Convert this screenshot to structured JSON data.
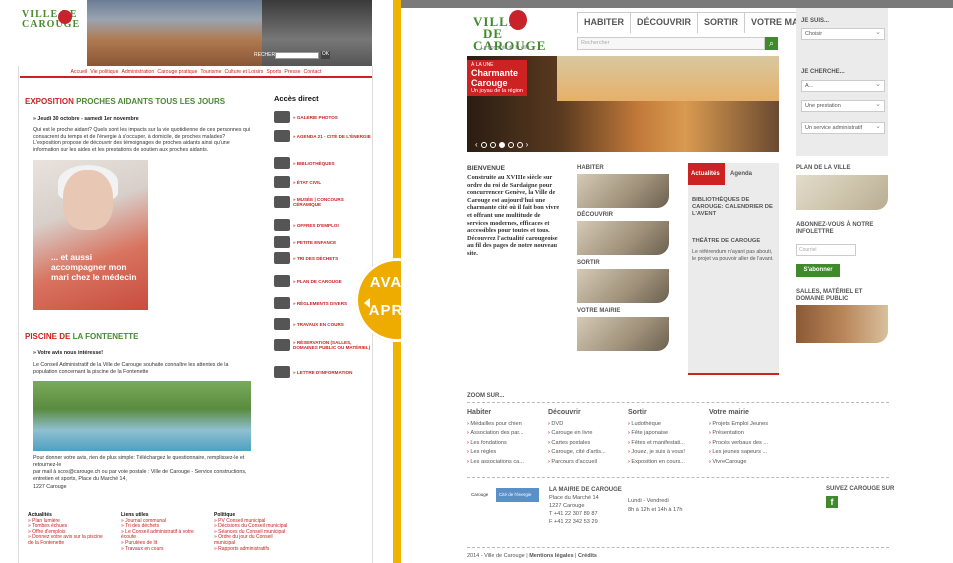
{
  "old": {
    "logo": "VILLE DE CAROUGE",
    "search_label": "RECHERCHE",
    "search_btn": "OK",
    "nav": [
      "Accueil",
      "Vie politique",
      "Administration",
      "Carouge pratique",
      "Tourisme",
      "Culture et Loisirs",
      "Sports",
      "Presse",
      "Contact"
    ],
    "headline_red": "EXPOSITION",
    "headline_green": "PROCHES AIDANTS TOUS LES JOURS",
    "date": "Jeudi 30 octobre - samedi 1er novembre",
    "body": "Qui est le proche aidant? Quels sont les impacts sur la vie quotidienne de ces personnes qui consacrent du temps et de l'énergie à s'occuper, à domicile, de proches malades? L'exposition propose de découvrir des témoignages de proches aidants ainsi qu'une information sur les aides et les prestations de soutien aux proches aidants.",
    "poster_text": "... et aussi accompagner mon mari chez le médecin",
    "h2_red": "PISCINE DE",
    "h2_green": "LA FONTENETTE",
    "sub2": "Votre avis nous intéresse!",
    "body2": "Le Conseil Administratif de la Ville de Carouge souhaite connaître les attentes de la population concernant la piscine de la Fontenette",
    "body3": "Pour donner votre avis, rien de plus simple: Téléchargez le questionnaire, remplissez-le et retournez-le",
    "body4": "par mail à scos@carouge.ch ou par voie postale : Ville de Carouge - Service constructions, entretien et sports, Place du Marché 14,",
    "body5": "1227 Carouge",
    "acces_title": "Accès direct",
    "acces": [
      "GALERIE PHOTOS",
      "AGENDA 21 - CITÉ DE L'ÉNERGIE",
      "BIBLIOTHÈQUES",
      "ÉTAT CIVIL",
      "MUSÉE | CONCOURS CÉRAMIQUE",
      "OFFRES D'EMPLOI",
      "PETITE ENFANCE",
      "TRI DES DÉCHETS",
      "PLAN DE CAROUGE",
      "RÈGLEMENTS DIVERS",
      "TRAVAUX EN COURS",
      "RÉSERVATION (SALLES, DOMAINES PUBLIC OU MATÉRIEL)",
      "LETTRE D'INFORMATION"
    ],
    "footer": [
      {
        "h": "Actualités",
        "items": [
          "Plan lumière",
          "Tombes échues",
          "Offre d'emplois",
          "Donnez votre avis sur la piscine de la Fontenette"
        ]
      },
      {
        "h": "Liens utiles",
        "items": [
          "Journal communal",
          "Tri des déchets",
          "Le Conseil administratif à votre écoute",
          "Purutées de lit",
          "Travaux en cours"
        ]
      },
      {
        "h": "Politique",
        "items": [
          "PV Conseil municipal",
          "Décisions du Conseil municipal",
          "Séances du Conseil municipal",
          "Ordre du jour du Conseil municipal",
          "Rapports administratifs"
        ]
      }
    ]
  },
  "badge": {
    "before": "AVANT",
    "after": "APRÈS"
  },
  "new": {
    "logo_line1": "VILLE",
    "logo_line2": "DE",
    "logo_line3": "CAROUGE",
    "tagline": "Le bon côté de la ville",
    "nav": [
      "HABITER",
      "DÉCOUVRIR",
      "SORTIR",
      "VOTRE MAIRIE"
    ],
    "search_placeholder": "Rechercher",
    "je_suis": "JE SUIS...",
    "choisir": "Choisir",
    "je_cherche": "JE CHERCHE...",
    "sel_a": "A...",
    "sel_prestation": "Une prestation",
    "sel_service": "Un service administratif",
    "hero_kicker": "À LA UNE",
    "hero_title": "Charmante Carouge",
    "hero_sub": "Un joyau de la région",
    "bienvenue_h": "BIENVENUE",
    "bienvenue_t": "Construite au XVIIIe siècle sur ordre du roi de Sardaigne pour concurrencer Genève, la Ville de Carouge est aujourd'hui une charmante cité où il fait bon vivre et offrant une multitude de services modernes, efficaces et accessibles pour toutes et tous. Découvrez l'actualité carougeoise au fil des pages de notre nouveau site.",
    "thumbs": [
      "HABITER",
      "DÉCOUVRIR",
      "SORTIR",
      "VOTRE MAIRIE"
    ],
    "tab_actu": "Actualités",
    "tab_agenda": "Agenda",
    "news1": "BIBLIOTHÈQUES DE CAROUGE: CALENDRIER DE L'AVENT",
    "news2": "THÉÂTRE DE CAROUGE",
    "news3": "Le référendum n'ayant pas abouti, le projet va pouvoir aller de l'avant.",
    "plan": "PLAN DE LA VILLE",
    "newsletter": "ABONNEZ-VOUS À NOTRE INFOLETTRE",
    "courriel": "Courriel",
    "abonner": "S'abonner",
    "salles": "SALLES, MATÉRIEL ET DOMAINE PUBLIC",
    "zoom": "ZOOM SUR...",
    "zcols": [
      {
        "h": "Habiter",
        "items": [
          "Médailles pour chien",
          "Association des par...",
          "Les fondations",
          "Les règles",
          "Les associations ca..."
        ]
      },
      {
        "h": "Découvrir",
        "items": [
          "DVD",
          "Carouge en livre",
          "Cartes postales",
          "Carouge, cité d'artis...",
          "Parcours d'accueil"
        ]
      },
      {
        "h": "Sortir",
        "items": [
          "Ludothèque",
          "Fête japonaise",
          "Fêtes et manifestati...",
          "Jouez, je suis à vous!",
          "Exposition en cours..."
        ]
      },
      {
        "h": "Votre mairie",
        "items": [
          "Projets Emploi Jeunes",
          "Présentation",
          "Procès verbaux des ...",
          "Les jeunes sapeurs ...",
          "VivreCarouge"
        ]
      }
    ],
    "mairie_h": "LA MAIRIE DE CAROUGE",
    "mairie_lines": [
      "Place du Marché 14",
      "1227 Carouge",
      "T +41 22 307 89 87",
      "F +41 22 342 53 29"
    ],
    "horaire": [
      "Lundi - Vendredi",
      "8h à 12h et 14h à 17h"
    ],
    "suivez": "SUIVEZ CAROUGE SUR",
    "copyright": "2014 - Ville de Carouge",
    "mentions": "Mentions légales",
    "credits": "Crédits",
    "logo_small": "Carouge",
    "cite": "Cité de l'énergie"
  }
}
